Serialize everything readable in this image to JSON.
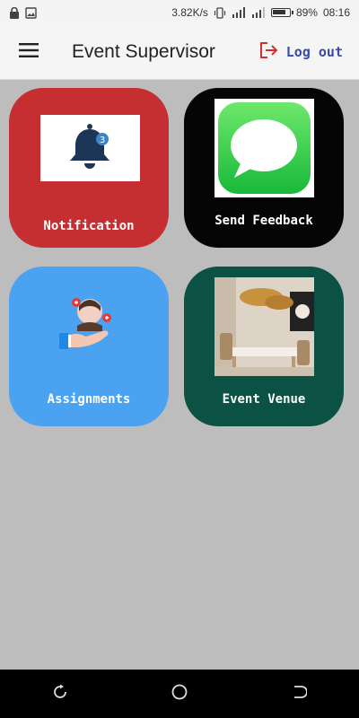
{
  "status_bar": {
    "network_speed": "3.82K/s",
    "battery": "89%",
    "battery_level": 0.89,
    "time": "08:16",
    "left_icons": [
      "lock-icon",
      "image-icon"
    ],
    "right_icons": [
      "vibrate-icon",
      "signal-icon",
      "signal-icon",
      "battery-icon"
    ]
  },
  "app_bar": {
    "title": "Event Supervisor",
    "menu_icon": "hamburger-menu-icon",
    "logout_label": "Log out",
    "logout_icon": "logout-icon",
    "logout_color": "#3a4aa8",
    "logout_icon_color": "#d32f2f"
  },
  "tiles": [
    {
      "label": "Notification",
      "icon": "bell-icon",
      "badge": "3",
      "color": "#c62f32"
    },
    {
      "label": "Send Feedback",
      "icon": "chat-bubble-icon",
      "color": "#050505"
    },
    {
      "label": "Assignments",
      "icon": "assignment-person-icon",
      "color": "#4aa2f0"
    },
    {
      "label": "Event Venue",
      "icon": "venue-photo",
      "color": "#0b5244"
    }
  ],
  "nav_bar": {
    "buttons": [
      "recent-apps-icon",
      "home-icon",
      "back-icon"
    ]
  }
}
